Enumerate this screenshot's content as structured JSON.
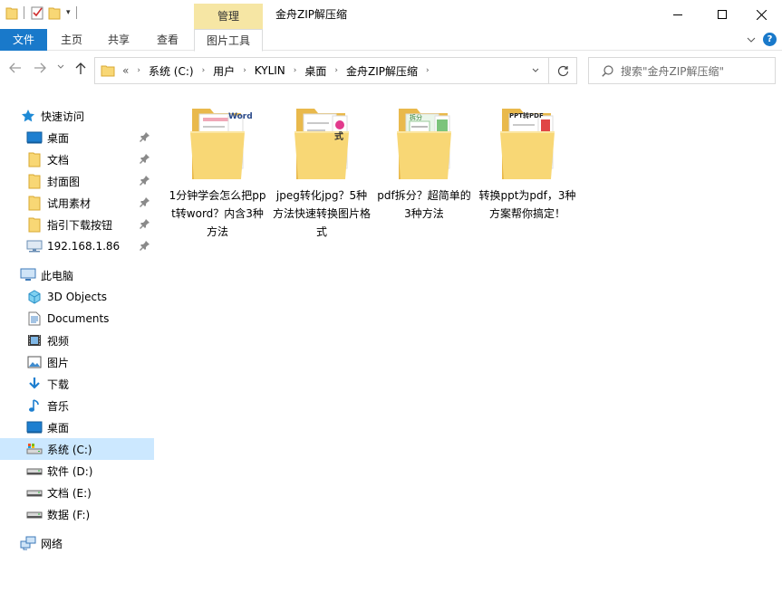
{
  "title_bar": {
    "context_tab": "管理",
    "window_title": "金舟ZIP解压缩"
  },
  "ribbon": {
    "tabs": [
      {
        "label": "文件"
      },
      {
        "label": "主页"
      },
      {
        "label": "共享"
      },
      {
        "label": "查看"
      },
      {
        "label": "图片工具"
      }
    ]
  },
  "address_bar": {
    "overflow": "«",
    "crumbs": [
      "系统 (C:)",
      "用户",
      "KYLIN",
      "桌面",
      "金舟ZIP解压缩"
    ]
  },
  "search": {
    "placeholder": "搜索\"金舟ZIP解压缩\""
  },
  "sidebar": {
    "quick_access": "快速访问",
    "pinned": [
      {
        "label": "桌面",
        "icon": "desktop-icon"
      },
      {
        "label": "文档",
        "icon": "folder-icon"
      },
      {
        "label": "封面图",
        "icon": "folder-icon"
      },
      {
        "label": "试用素材",
        "icon": "folder-icon"
      },
      {
        "label": "指引下载按钮",
        "icon": "folder-icon"
      },
      {
        "label": "192.168.1.86",
        "icon": "network-drive-icon"
      }
    ],
    "this_pc": "此电脑",
    "pc_items": [
      {
        "label": "3D Objects",
        "icon": "cube-icon"
      },
      {
        "label": "Documents",
        "icon": "documents-icon"
      },
      {
        "label": "视频",
        "icon": "video-icon"
      },
      {
        "label": "图片",
        "icon": "pictures-icon"
      },
      {
        "label": "下载",
        "icon": "download-icon"
      },
      {
        "label": "音乐",
        "icon": "music-icon"
      },
      {
        "label": "桌面",
        "icon": "desktop-icon"
      },
      {
        "label": "系统 (C:)",
        "icon": "drive-icon"
      },
      {
        "label": "软件 (D:)",
        "icon": "drive-icon"
      },
      {
        "label": "文档 (E:)",
        "icon": "drive-icon"
      },
      {
        "label": "数据 (F:)",
        "icon": "drive-icon"
      }
    ],
    "network": "网络",
    "selected": "系统 (C:)"
  },
  "files": [
    {
      "name": "1分钟学会怎么把ppt转word？内含3种方法",
      "thumb_text": "Word"
    },
    {
      "name": "jpeg转化jpg？5种方法快速转换图片格式",
      "thumb_text": "式"
    },
    {
      "name": "pdf拆分？超简单的3种方法",
      "thumb_text": "拆分"
    },
    {
      "name": "转换ppt为pdf，3种方案帮你搞定！",
      "thumb_text": "PPT转PDF"
    }
  ],
  "colors": {
    "accent": "#1979ca",
    "context_tab": "#f6e6a4",
    "selection": "#cce8ff",
    "folder": "#f8d775"
  }
}
